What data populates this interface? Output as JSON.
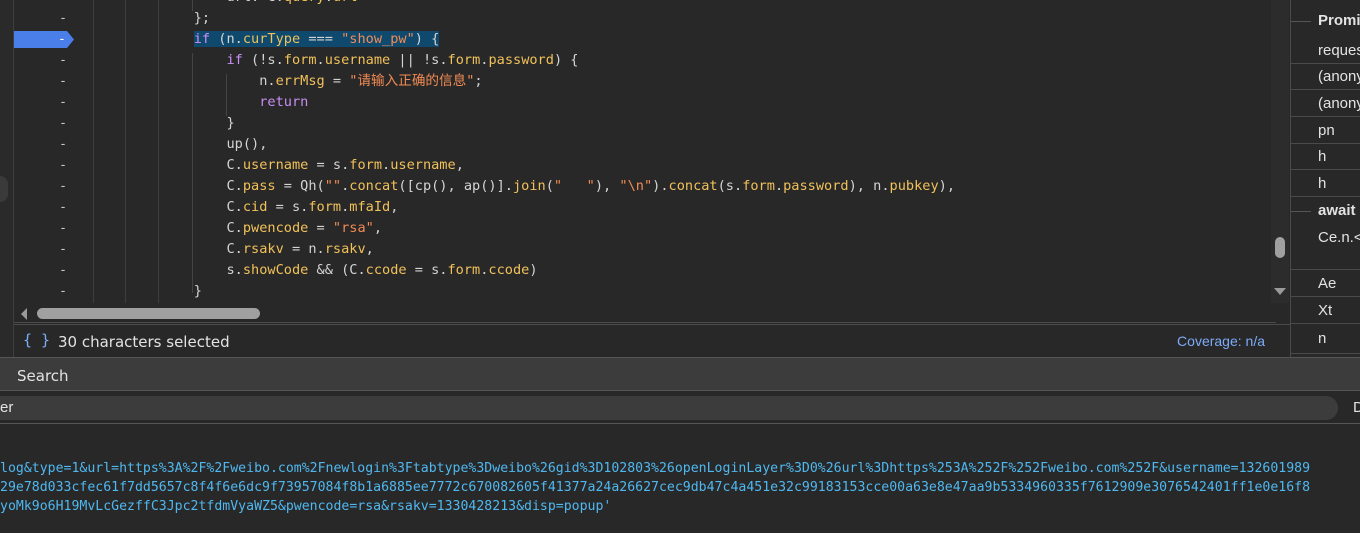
{
  "editor": {
    "code_lines": [
      [
        [
          "p",
          "    url: "
        ],
        [
          "p",
          "C"
        ],
        [
          "p",
          "."
        ],
        [
          "y",
          "query"
        ],
        [
          "p",
          "."
        ],
        [
          "y",
          "url"
        ]
      ],
      [
        [
          "p",
          "};"
        ]
      ],
      [
        [
          "k",
          "if"
        ],
        [
          "p",
          " (n."
        ],
        [
          "y",
          "curType"
        ],
        [
          "p",
          " === "
        ],
        [
          "s",
          "\"show_pw\""
        ],
        [
          "p",
          ") {"
        ]
      ],
      [
        [
          "p",
          "    "
        ],
        [
          "k",
          "if"
        ],
        [
          "p",
          " (!s."
        ],
        [
          "y",
          "form"
        ],
        [
          "p",
          "."
        ],
        [
          "y",
          "username"
        ],
        [
          "p",
          " || !s."
        ],
        [
          "y",
          "form"
        ],
        [
          "p",
          "."
        ],
        [
          "y",
          "password"
        ],
        [
          "p",
          ") {"
        ]
      ],
      [
        [
          "p",
          "        n."
        ],
        [
          "y",
          "errMsg"
        ],
        [
          "p",
          " = "
        ],
        [
          "s",
          "\"请输入正确的信息\""
        ],
        [
          "p",
          ";"
        ]
      ],
      [
        [
          "p",
          "        "
        ],
        [
          "k",
          "return"
        ]
      ],
      [
        [
          "p",
          "    }"
        ]
      ],
      [
        [
          "p",
          "    up(),"
        ]
      ],
      [
        [
          "p",
          "    C."
        ],
        [
          "y",
          "username"
        ],
        [
          "p",
          " = s."
        ],
        [
          "y",
          "form"
        ],
        [
          "p",
          "."
        ],
        [
          "y",
          "username"
        ],
        [
          "p",
          ","
        ]
      ],
      [
        [
          "p",
          "    C."
        ],
        [
          "y",
          "pass"
        ],
        [
          "p",
          " = Qh("
        ],
        [
          "s",
          "\"\""
        ],
        [
          "p",
          "."
        ],
        [
          "y",
          "concat"
        ],
        [
          "p",
          "([cp(), ap()]."
        ],
        [
          "y",
          "join"
        ],
        [
          "p",
          "("
        ],
        [
          "s",
          "\"   \""
        ],
        [
          "p",
          "), "
        ],
        [
          "s",
          "\"\\n\""
        ],
        [
          "p",
          ")."
        ],
        [
          "y",
          "concat"
        ],
        [
          "p",
          "(s."
        ],
        [
          "y",
          "form"
        ],
        [
          "p",
          "."
        ],
        [
          "y",
          "password"
        ],
        [
          "p",
          "), n."
        ],
        [
          "y",
          "pubkey"
        ],
        [
          "p",
          "),"
        ]
      ],
      [
        [
          "p",
          "    C."
        ],
        [
          "y",
          "cid"
        ],
        [
          "p",
          " = s."
        ],
        [
          "y",
          "form"
        ],
        [
          "p",
          "."
        ],
        [
          "y",
          "mfaId"
        ],
        [
          "p",
          ","
        ]
      ],
      [
        [
          "p",
          "    C."
        ],
        [
          "y",
          "pwencode"
        ],
        [
          "p",
          " = "
        ],
        [
          "s",
          "\"rsa\""
        ],
        [
          "p",
          ","
        ]
      ],
      [
        [
          "p",
          "    C."
        ],
        [
          "y",
          "rsakv"
        ],
        [
          "p",
          " = n."
        ],
        [
          "y",
          "rsakv"
        ],
        [
          "p",
          ","
        ]
      ],
      [
        [
          "p",
          "    s."
        ],
        [
          "y",
          "showCode"
        ],
        [
          "p",
          " && (C."
        ],
        [
          "y",
          "ccode"
        ],
        [
          "p",
          " = s."
        ],
        [
          "y",
          "form"
        ],
        [
          "p",
          "."
        ],
        [
          "y",
          "ccode"
        ],
        [
          "p",
          ")"
        ]
      ],
      [
        [
          "p",
          "}"
        ]
      ]
    ],
    "gutter_marker": "-",
    "selected_line_index": 2
  },
  "status": {
    "format_icon": "{ }",
    "selection": "30 characters selected",
    "coverage": "Coverage: n/a"
  },
  "call_stack": [
    {
      "label": "Promi",
      "bold": true
    },
    {
      "label": "reques"
    },
    {
      "label": "(anony"
    },
    {
      "label": "(anony"
    },
    {
      "label": "pn"
    },
    {
      "label": "h"
    },
    {
      "label": "h"
    },
    {
      "label": "await",
      "bold": true
    },
    {
      "label": "Ce.n.<"
    },
    {
      "label": "Ae"
    },
    {
      "label": "Xt"
    },
    {
      "label": "n"
    }
  ],
  "search": {
    "tab_label": "Search",
    "input_value": "er",
    "right_label": "D",
    "results": [
      "log&type=1&url=https%3A%2F%2Fweibo.com%2Fnewlogin%3Ftabtype%3Dweibo%26gid%3D102803%26openLoginLayer%3D0%26url%3Dhttps%253A%252F%252Fweibo.com%252F&username=132601989",
      "29e78d033cfec61f7dd5657c8f4f6e6dc9f73957084f8b1a6885ee7772c670082605f41377a24a26627cec9db47c4a451e32c99183153cce00a63e8e47aa9b5334960335f7612909e3076542401ff1e0e16f8",
      "yoMk9o6H19MvLcGezffC3Jpc2tfdmVyaWZ5&pwencode=rsa&rsakv=1330428213&disp=popup'"
    ]
  }
}
